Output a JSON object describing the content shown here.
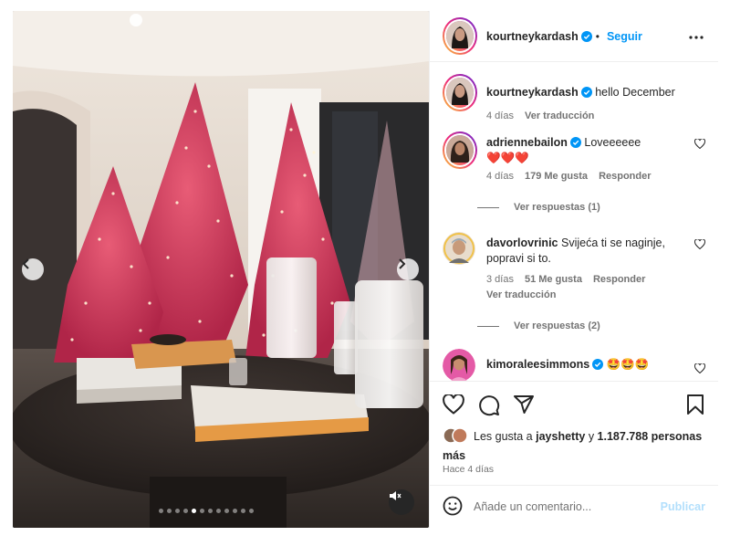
{
  "post": {
    "author": "kourtneykardash",
    "follow_label": "Seguir",
    "more_label": "•••",
    "caption": "hello December",
    "caption_time": "4 días",
    "caption_translate": "Ver traducción",
    "media": {
      "carousel_dots": 12,
      "active_dot": 4
    }
  },
  "comments": [
    {
      "user": "adriennebailon",
      "verified": true,
      "text": "Loveeeeee",
      "emojis": "❤️❤️❤️",
      "time": "4 días",
      "likes": "179 Me gusta",
      "reply": "Responder",
      "view_replies": "Ver respuestas (1)"
    },
    {
      "user": "davorlovrinic",
      "verified": false,
      "text": "Svijeća ti se naginje, popravi si to.",
      "time": "3 días",
      "likes": "51 Me gusta",
      "reply": "Responder",
      "translate": "Ver traducción",
      "view_replies": "Ver respuestas (2)"
    },
    {
      "user": "kimoraleesimmons",
      "verified": true,
      "text": "🤩🤩🤩"
    }
  ],
  "likes": {
    "prefix": "Les gusta a",
    "user": "jayshetty",
    "middle": "y",
    "count": "1.187.788 personas más"
  },
  "time_ago": "Hace 4 días",
  "comment_input": {
    "placeholder": "Añade un comentario...",
    "publish_label": "Publicar"
  },
  "colors": {
    "link_blue": "#0095f6",
    "verified_blue": "#0095f6",
    "muted": "#737373",
    "publish_disabled": "#b2dffc"
  }
}
